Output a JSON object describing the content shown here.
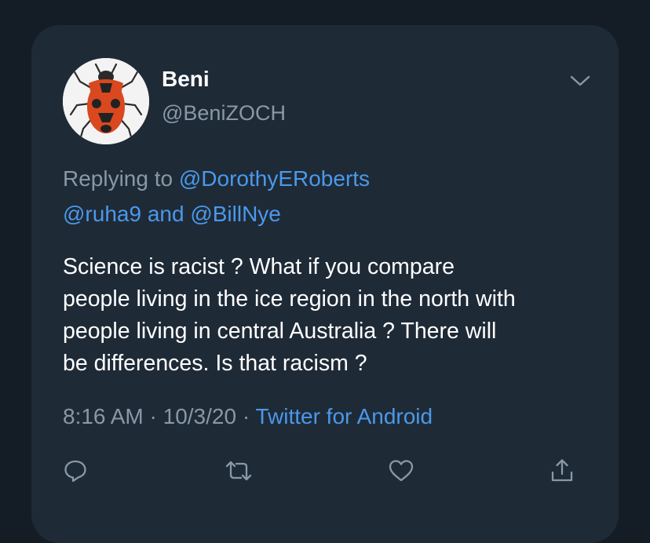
{
  "tweet": {
    "display_name": "Beni",
    "handle": "@BeniZOCH",
    "reply_prefix": "Replying to",
    "reply_mention_1": "@DorothyERoberts",
    "reply_mention_2": "@ruha9",
    "reply_and": "and",
    "reply_mention_3": "@BillNye",
    "text_lines": [
      "Science is racist ? What if you compare",
      "people living in the ice region in the north with",
      "people living in central Australia ? There will",
      "be differences. Is that racism ?"
    ],
    "time": "8:16 AM",
    "separator": "·",
    "date": "10/3/20",
    "source": "Twitter for Android"
  },
  "icons": {
    "menu": "chevron-down-icon",
    "reply": "reply-icon",
    "retweet": "retweet-icon",
    "like": "heart-icon",
    "share": "share-icon"
  },
  "colors": {
    "background": "#141d26",
    "card": "#1f2a37",
    "text": "#ffffff",
    "secondary": "#8899a6",
    "link": "#4a99e9"
  }
}
